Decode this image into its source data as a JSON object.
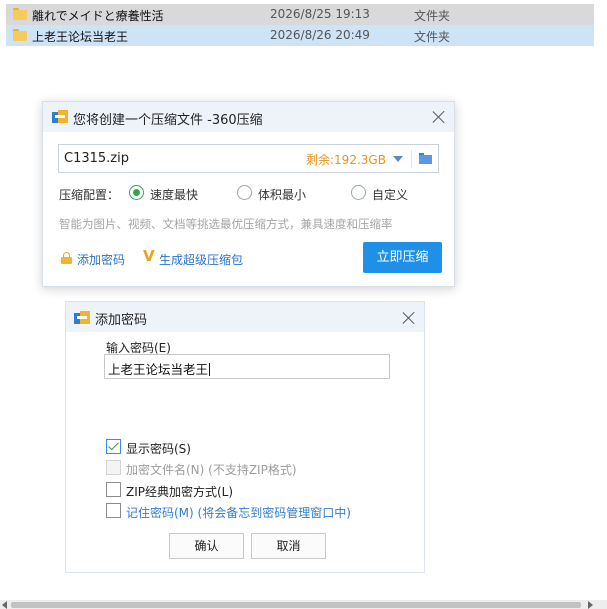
{
  "explorer": {
    "rows": [
      {
        "name": "離れでメイドと療養性活",
        "date": "2026/8/25 19:13",
        "type": "文件夹"
      },
      {
        "name": "上老王论坛当老王",
        "date": "2026/8/26 20:49",
        "type": "文件夹"
      }
    ]
  },
  "compress_dialog": {
    "title": "您将创建一个压缩文件 -360压缩",
    "filename": "C1315.zip",
    "space_left": "剩余:192.3GB",
    "config_label": "压缩配置：",
    "options": [
      {
        "label": "速度最快",
        "selected": true
      },
      {
        "label": "体积最小",
        "selected": false
      },
      {
        "label": "自定义",
        "selected": false
      }
    ],
    "hint": "智能为图片、视频、文档等挑选最优压缩方式，兼具速度和压缩率",
    "add_password_link": "添加密码",
    "super_package_link": "生成超级压缩包",
    "compress_button": "立即压缩"
  },
  "password_dialog": {
    "title": "添加密码",
    "input_label": "输入密码(E)",
    "password_value": "上老王论坛当老王",
    "checkboxes": [
      {
        "label": "显示密码(S)",
        "checked": true,
        "disabled": false
      },
      {
        "label": "加密文件名(N) (不支持ZIP格式)",
        "checked": false,
        "disabled": true
      },
      {
        "label": "ZIP经典加密方式(L)",
        "checked": false,
        "disabled": false
      },
      {
        "label": "记住密码(M) (将会备忘到密码管理窗口中)",
        "checked": false,
        "disabled": false
      }
    ],
    "ok_button": "确认",
    "cancel_button": "取消"
  },
  "colors": {
    "accent_blue": "#1e90e8",
    "link_blue": "#2a73c9",
    "space_orange": "#e8931b",
    "radio_green": "#2ea84f"
  }
}
